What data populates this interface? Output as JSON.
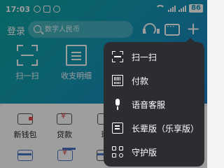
{
  "status_bar": {
    "time": "17:03",
    "battery": "86"
  },
  "header": {
    "login_label": "登录",
    "search_placeholder": "数字人民币"
  },
  "quick_actions": [
    {
      "label": "扫一扫",
      "icon": "scan-icon"
    },
    {
      "label": "收支明细",
      "icon": "bill-icon"
    }
  ],
  "services": [
    {
      "label": "新钱包",
      "icon": "wallet-icon"
    },
    {
      "label": "贷款",
      "icon": "loan-icon"
    },
    {
      "label": "理",
      "icon": "finance-icon"
    }
  ],
  "popup_menu": {
    "items": [
      {
        "label": "扫一扫",
        "icon": "scan-icon"
      },
      {
        "label": "付款",
        "icon": "barcode-icon"
      },
      {
        "label": "语音客服",
        "icon": "microphone-icon"
      },
      {
        "label": "长辈版（乐享版）",
        "icon": "elder-mode-icon"
      },
      {
        "label": "守护版",
        "icon": "guardian-icon"
      }
    ]
  },
  "colors": {
    "header_gradient_start": "#0fa6a0",
    "header_gradient_end": "#1a7fc2",
    "menu_background": "#2b2d31",
    "accent_red": "#e34848"
  }
}
